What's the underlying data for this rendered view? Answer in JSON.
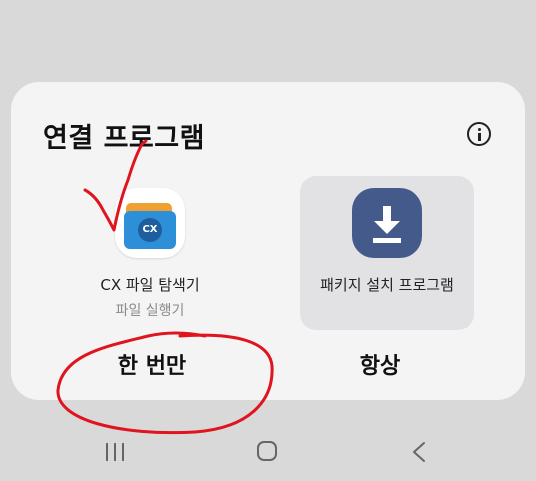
{
  "dialog": {
    "title": "연결 프로그램",
    "info_icon": "info-circle-icon"
  },
  "apps": [
    {
      "name": "CX 파일 탐색기",
      "subtitle": "파일 실행기",
      "icon": "cx-file-explorer-folder-icon",
      "icon_badge": "CX"
    },
    {
      "name": "패키지 설치 프로그램",
      "icon": "package-installer-download-icon",
      "selected": true
    }
  ],
  "actions": {
    "just_once": "한 번만",
    "always": "항상"
  },
  "navbar": {
    "recent": "recent-apps-icon",
    "home": "home-icon",
    "back": "back-icon"
  },
  "colors": {
    "screen_bg": "#d9d9d9",
    "sheet_bg": "#f4f4f4",
    "selected_app_bg": "#e2e2e4",
    "installer_icon_bg": "#435a8b",
    "annotation": "#e0141e"
  }
}
